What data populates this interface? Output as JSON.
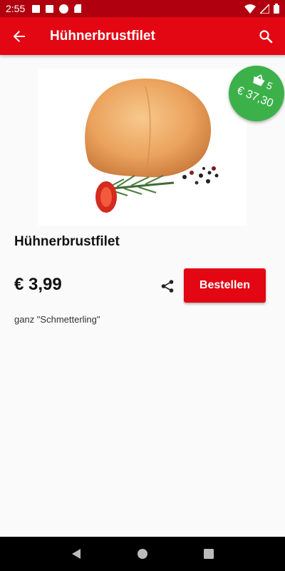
{
  "status_bar": {
    "time": "2:55"
  },
  "app_bar": {
    "title": "Hühnerbrustfilet",
    "back_icon": "arrow-back-icon",
    "search_icon": "search-icon"
  },
  "cart_badge": {
    "count": "5",
    "total": "€ 37,30",
    "color": "#3cb14a"
  },
  "product": {
    "name": "Hühnerbrustfilet",
    "price": "€ 3,99",
    "description": "ganz \"Schmetterling\"",
    "order_label": "Bestellen"
  },
  "colors": {
    "accent": "#e30613",
    "status_bar": "#b0000f"
  }
}
